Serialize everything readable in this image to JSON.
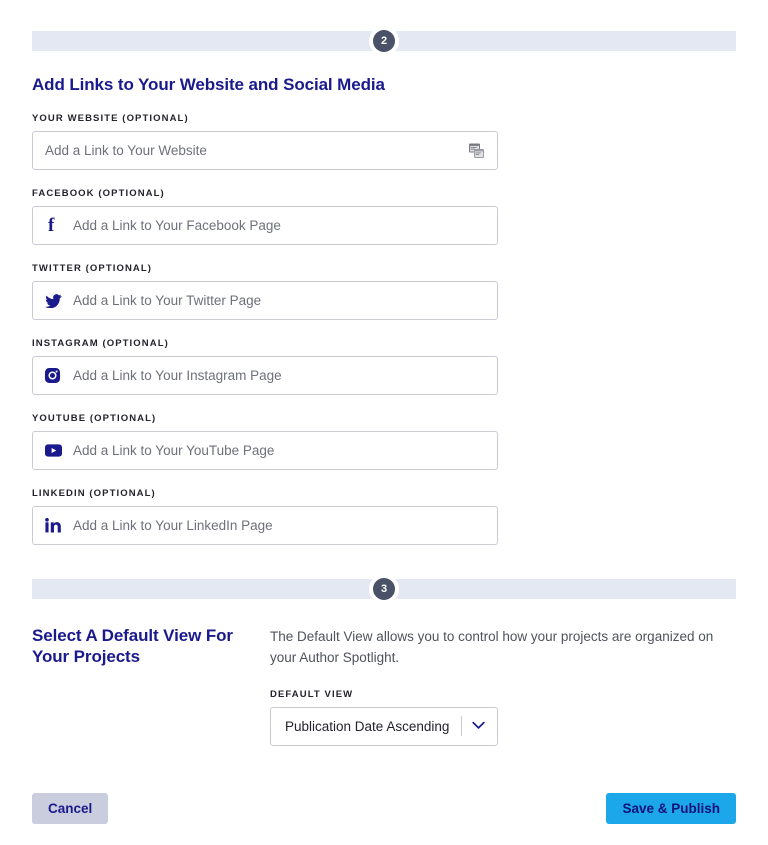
{
  "steps": {
    "step2_number": "2",
    "step3_number": "3"
  },
  "colors": {
    "heading_navy": "#1a1a8c",
    "step_badge": "#4a5268",
    "step_bar": "#e4e8f3",
    "publish_blue": "#1ca7ea",
    "cancel_grey": "#c9cddd",
    "border_grey": "#c9ccd6",
    "placeholder_grey": "#6e7179"
  },
  "section2": {
    "title": "Add Links to Your Website and Social Media",
    "fields": [
      {
        "label": "YOUR WEBSITE (OPTIONAL)",
        "placeholder": "Add a Link to Your Website",
        "value": "",
        "lead_icon": "",
        "trail_icon": "browser-window-icon"
      },
      {
        "label": "FACEBOOK (OPTIONAL)",
        "placeholder": "Add a Link to Your Facebook Page",
        "value": "",
        "lead_icon": "facebook-icon",
        "trail_icon": ""
      },
      {
        "label": "TWITTER (OPTIONAL)",
        "placeholder": "Add a Link to Your Twitter Page",
        "value": "",
        "lead_icon": "twitter-icon",
        "trail_icon": ""
      },
      {
        "label": "INSTAGRAM (OPTIONAL)",
        "placeholder": "Add a Link to Your Instagram Page",
        "value": "",
        "lead_icon": "instagram-icon",
        "trail_icon": ""
      },
      {
        "label": "YOUTUBE (OPTIONAL)",
        "placeholder": "Add a Link to Your YouTube Page",
        "value": "",
        "lead_icon": "youtube-icon",
        "trail_icon": ""
      },
      {
        "label": "LINKEDIN (OPTIONAL)",
        "placeholder": "Add a Link to Your LinkedIn Page",
        "value": "",
        "lead_icon": "linkedin-icon",
        "trail_icon": ""
      }
    ]
  },
  "section3": {
    "title": "Select A Default View For Your Projects",
    "description": "The Default View allows you to control how your projects are organized on your Author Spotlight.",
    "select": {
      "label": "DEFAULT VIEW",
      "selected": "Publication Date Ascending",
      "icon": "chevron-down-icon"
    }
  },
  "footer": {
    "cancel_label": "Cancel",
    "publish_label": "Save & Publish"
  }
}
